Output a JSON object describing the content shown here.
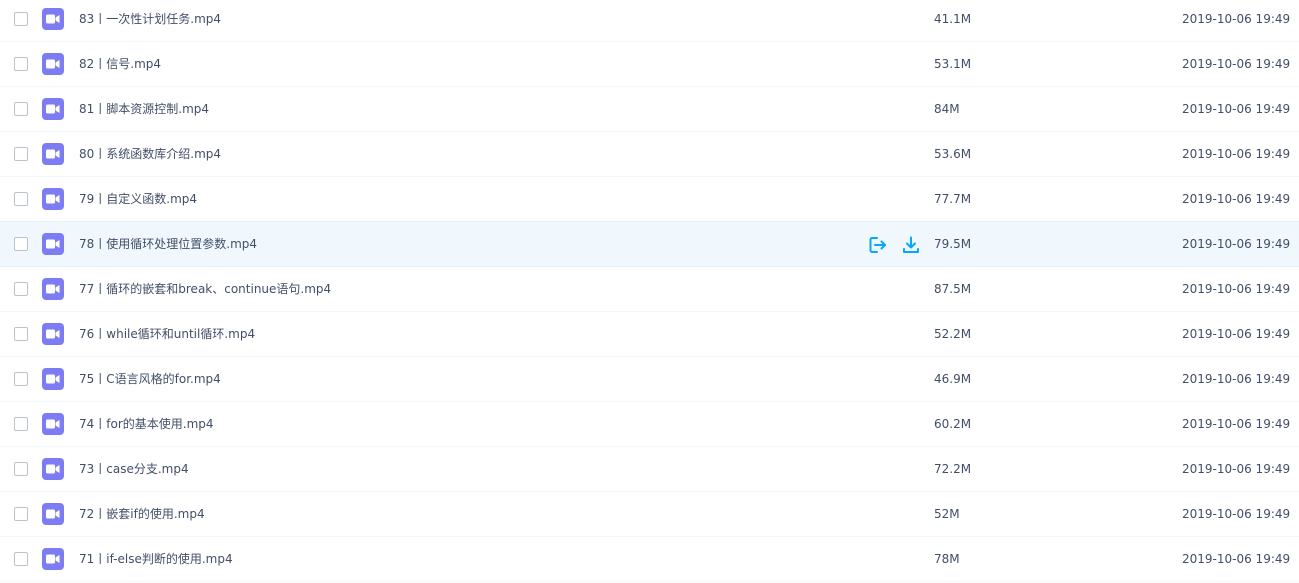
{
  "files": [
    {
      "name": "83丨一次性计划任务.mp4",
      "size": "41.1M",
      "modified": "2019-10-06 19:49",
      "icon": "video-icon"
    },
    {
      "name": "82丨信号.mp4",
      "size": "53.1M",
      "modified": "2019-10-06 19:49",
      "icon": "video-icon"
    },
    {
      "name": "81丨脚本资源控制.mp4",
      "size": "84M",
      "modified": "2019-10-06 19:49",
      "icon": "video-icon"
    },
    {
      "name": "80丨系统函数库介绍.mp4",
      "size": "53.6M",
      "modified": "2019-10-06 19:49",
      "icon": "video-icon"
    },
    {
      "name": "79丨自定义函数.mp4",
      "size": "77.7M",
      "modified": "2019-10-06 19:49",
      "icon": "video-icon"
    },
    {
      "name": "78丨使用循环处理位置参数.mp4",
      "size": "79.5M",
      "modified": "2019-10-06 19:49",
      "icon": "video-icon",
      "hovered": true
    },
    {
      "name": "77丨循环的嵌套和break、continue语句.mp4",
      "size": "87.5M",
      "modified": "2019-10-06 19:49",
      "icon": "video-icon"
    },
    {
      "name": "76丨while循环和until循环.mp4",
      "size": "52.2M",
      "modified": "2019-10-06 19:49",
      "icon": "video-icon"
    },
    {
      "name": "75丨C语言风格的for.mp4",
      "size": "46.9M",
      "modified": "2019-10-06 19:49",
      "icon": "video-icon"
    },
    {
      "name": "74丨for的基本使用.mp4",
      "size": "60.2M",
      "modified": "2019-10-06 19:49",
      "icon": "video-icon"
    },
    {
      "name": "73丨case分支.mp4",
      "size": "72.2M",
      "modified": "2019-10-06 19:49",
      "icon": "video-icon"
    },
    {
      "name": "72丨嵌套if的使用.mp4",
      "size": "52M",
      "modified": "2019-10-06 19:49",
      "icon": "video-icon"
    },
    {
      "name": "71丨if-else判断的使用.mp4",
      "size": "78M",
      "modified": "2019-10-06 19:49",
      "icon": "video-icon"
    }
  ],
  "row_actions": {
    "share_icon": "share-icon",
    "download_icon": "download-icon"
  },
  "colors": {
    "text": "#424e67",
    "video_icon_bg": "#7d7cf2",
    "hover_row_bg": "#f0f8fe",
    "action_icon": "#06a7ff"
  }
}
